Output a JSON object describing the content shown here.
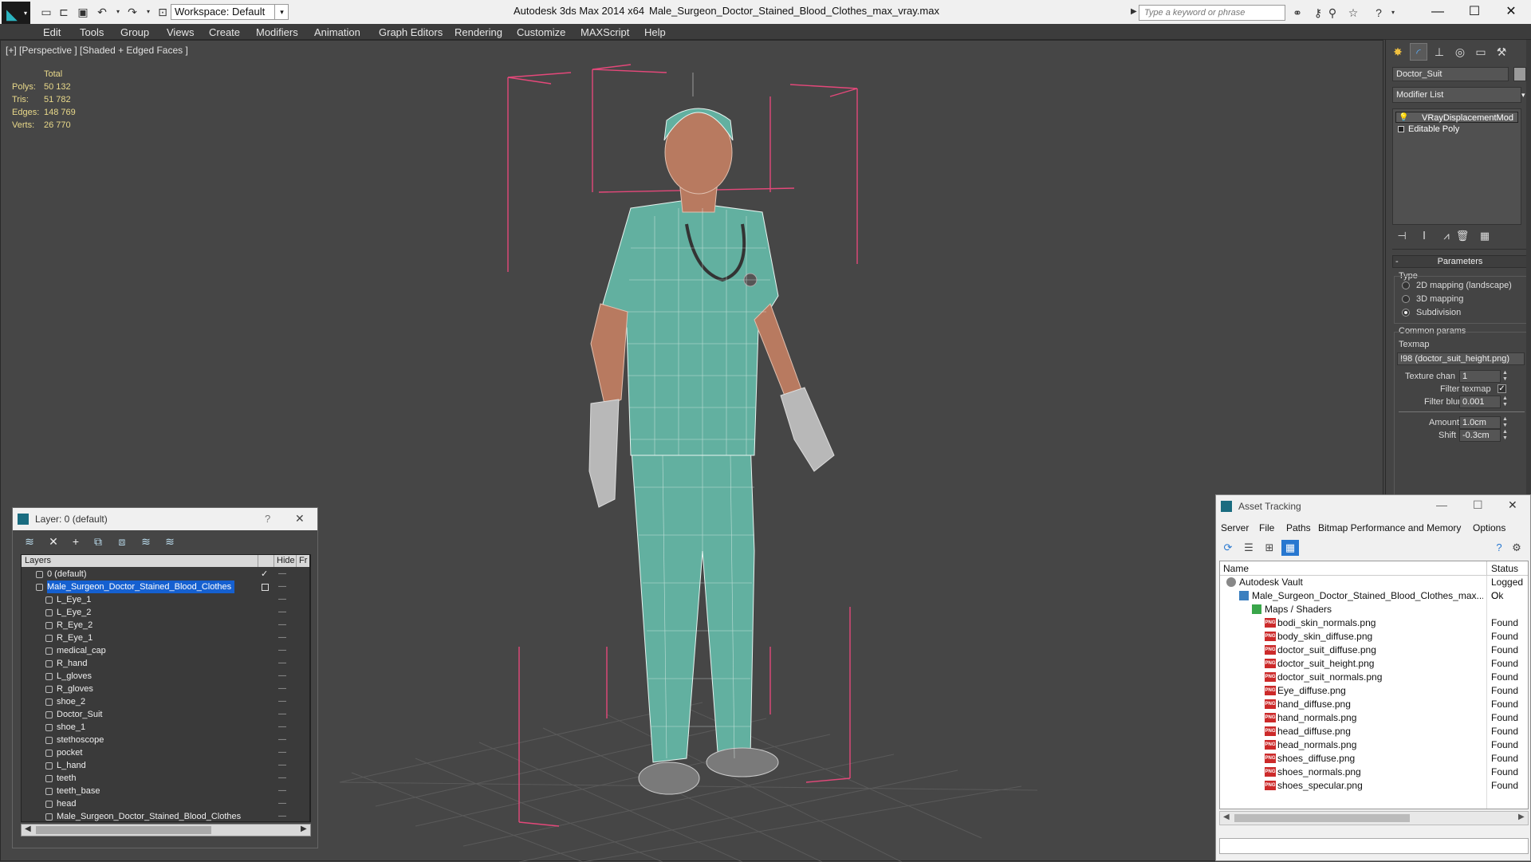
{
  "titlebar": {
    "workspace_label": "Workspace: Default",
    "app_title": "Autodesk 3ds Max  2014 x64",
    "file_title": "Male_Surgeon_Doctor_Stained_Blood_Clothes_max_vray.max",
    "search_placeholder": "Type a keyword or phrase"
  },
  "menu": [
    "Edit",
    "Tools",
    "Group",
    "Views",
    "Create",
    "Modifiers",
    "Animation",
    "Graph Editors",
    "Rendering",
    "Customize",
    "MAXScript",
    "Help"
  ],
  "viewport": {
    "label": "[+] [Perspective ] [Shaded + Edged Faces ]",
    "stats": {
      "header": "Total",
      "rows": [
        {
          "label": "Polys:",
          "value": "50 132"
        },
        {
          "label": "Tris:",
          "value": "51 782"
        },
        {
          "label": "Edges:",
          "value": "148 769"
        },
        {
          "label": "Verts:",
          "value": "26 770"
        }
      ]
    }
  },
  "command_panel": {
    "object_name": "Doctor_Suit",
    "modifier_list": "Modifier List",
    "stack": [
      "VRayDisplacementMod",
      "Editable Poly"
    ],
    "parameters_title": "Parameters",
    "type_label": "Type",
    "type_options": [
      "2D mapping (landscape)",
      "3D mapping",
      "Subdivision"
    ],
    "type_selected": 2,
    "common_params": "Common params",
    "texmap_label": "Texmap",
    "texmap_value": "!98 (doctor_suit_height.png)",
    "texture_chan_label": "Texture chan",
    "texture_chan_value": "1",
    "filter_texmap_label": "Filter texmap",
    "filter_blur_label": "Filter blur",
    "filter_blur_value": "0.001",
    "amount_label": "Amount",
    "amount_value": "1.0cm",
    "shift_label": "Shift",
    "shift_value": "-0.3cm"
  },
  "layer_dialog": {
    "title": "Layer: 0 (default)",
    "help": "?",
    "col_layers": "Layers",
    "col_hide": "Hide",
    "col_fr": "Fr",
    "rows": [
      {
        "name": "0 (default)",
        "indent": 0,
        "type": "layer"
      },
      {
        "name": "Male_Surgeon_Doctor_Stained_Blood_Clothes",
        "indent": 0,
        "type": "layer",
        "selected": true
      },
      {
        "name": "L_Eye_1",
        "indent": 1,
        "type": "object"
      },
      {
        "name": "L_Eye_2",
        "indent": 1,
        "type": "object"
      },
      {
        "name": "R_Eye_2",
        "indent": 1,
        "type": "object"
      },
      {
        "name": "R_Eye_1",
        "indent": 1,
        "type": "object"
      },
      {
        "name": "medical_cap",
        "indent": 1,
        "type": "object"
      },
      {
        "name": "R_hand",
        "indent": 1,
        "type": "object"
      },
      {
        "name": "L_gloves",
        "indent": 1,
        "type": "object"
      },
      {
        "name": "R_gloves",
        "indent": 1,
        "type": "object"
      },
      {
        "name": "shoe_2",
        "indent": 1,
        "type": "object"
      },
      {
        "name": "Doctor_Suit",
        "indent": 1,
        "type": "object"
      },
      {
        "name": "shoe_1",
        "indent": 1,
        "type": "object"
      },
      {
        "name": "stethoscope",
        "indent": 1,
        "type": "object"
      },
      {
        "name": "pocket",
        "indent": 1,
        "type": "object"
      },
      {
        "name": "L_hand",
        "indent": 1,
        "type": "object"
      },
      {
        "name": "teeth",
        "indent": 1,
        "type": "object"
      },
      {
        "name": "teeth_base",
        "indent": 1,
        "type": "object"
      },
      {
        "name": "head",
        "indent": 1,
        "type": "object"
      },
      {
        "name": "Male_Surgeon_Doctor_Stained_Blood_Clothes",
        "indent": 1,
        "type": "object"
      }
    ]
  },
  "asset_tracking": {
    "title": "Asset Tracking",
    "menu": [
      "Server",
      "File",
      "Paths",
      "Bitmap Performance and Memory",
      "Options"
    ],
    "col_name": "Name",
    "col_status": "Status",
    "rows": [
      {
        "name": "Autodesk Vault",
        "status": "Logged O",
        "indent": 0,
        "kind": "vault"
      },
      {
        "name": "Male_Surgeon_Doctor_Stained_Blood_Clothes_max...",
        "status": "Ok",
        "indent": 1,
        "kind": "max"
      },
      {
        "name": "Maps / Shaders",
        "status": "",
        "indent": 2,
        "kind": "maps"
      },
      {
        "name": "bodi_skin_normals.png",
        "status": "Found",
        "indent": 3,
        "kind": "png"
      },
      {
        "name": "body_skin_diffuse.png",
        "status": "Found",
        "indent": 3,
        "kind": "png"
      },
      {
        "name": "doctor_suit_diffuse.png",
        "status": "Found",
        "indent": 3,
        "kind": "png"
      },
      {
        "name": "doctor_suit_height.png",
        "status": "Found",
        "indent": 3,
        "kind": "png"
      },
      {
        "name": "doctor_suit_normals.png",
        "status": "Found",
        "indent": 3,
        "kind": "png"
      },
      {
        "name": "Eye_diffuse.png",
        "status": "Found",
        "indent": 3,
        "kind": "png"
      },
      {
        "name": "hand_diffuse.png",
        "status": "Found",
        "indent": 3,
        "kind": "png"
      },
      {
        "name": "hand_normals.png",
        "status": "Found",
        "indent": 3,
        "kind": "png"
      },
      {
        "name": "head_diffuse.png",
        "status": "Found",
        "indent": 3,
        "kind": "png"
      },
      {
        "name": "head_normals.png",
        "status": "Found",
        "indent": 3,
        "kind": "png"
      },
      {
        "name": "shoes_diffuse.png",
        "status": "Found",
        "indent": 3,
        "kind": "png"
      },
      {
        "name": "shoes_normals.png",
        "status": "Found",
        "indent": 3,
        "kind": "png"
      },
      {
        "name": "shoes_specular.png",
        "status": "Found",
        "indent": 3,
        "kind": "png"
      }
    ]
  },
  "colors": {
    "suit": "#62b0a0",
    "skin": "#b87a60",
    "bbox": "#e4487a",
    "selection": "#1560d0",
    "stats_text": "#e9d98a"
  }
}
